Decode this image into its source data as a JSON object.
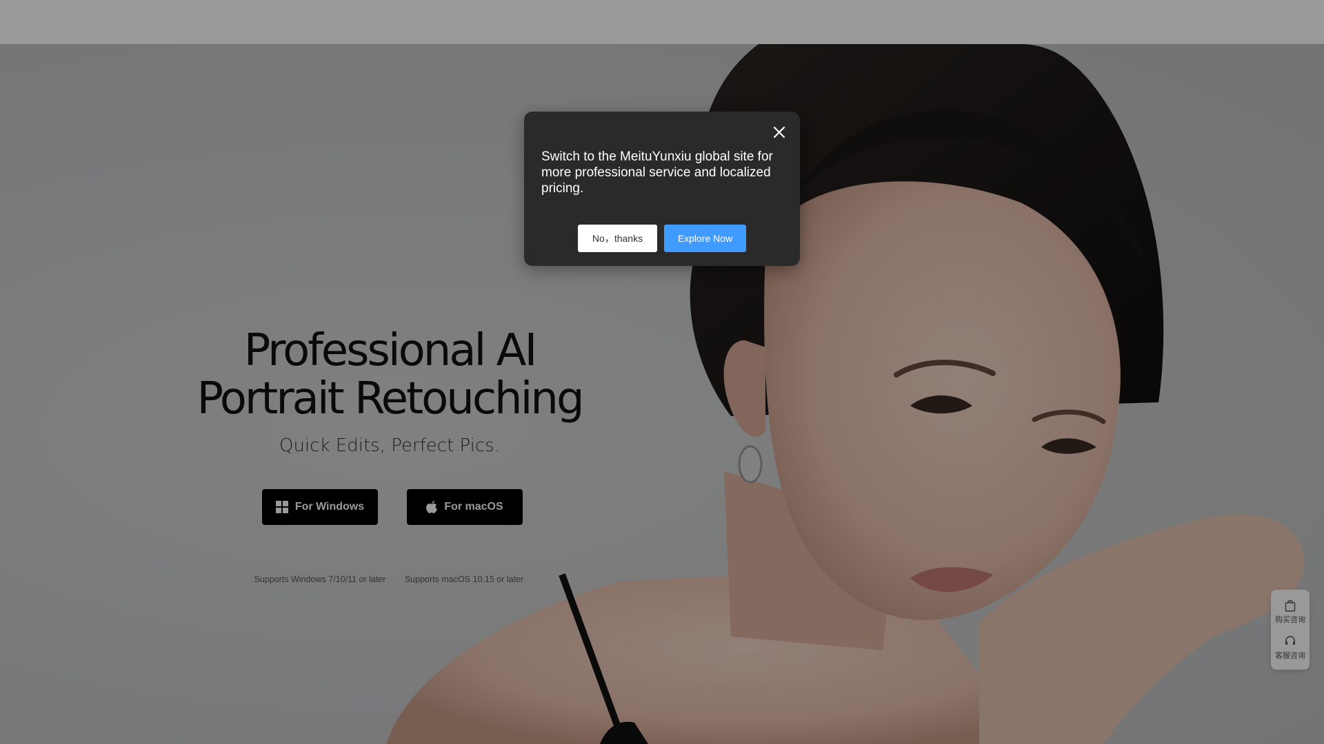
{
  "hero": {
    "title_line1": "Professional AI",
    "title_line2": "Portrait Retouching",
    "subtitle": "Quick Edits, Perfect Pics.",
    "download_windows": {
      "label": "For Windows",
      "note": "Supports Windows 7/10/11 or later",
      "icon": "windows-icon"
    },
    "download_mac": {
      "label": "For macOS",
      "note": "Supports macOS 10.15 or later",
      "icon": "apple-icon"
    },
    "image": "portrait-photo"
  },
  "side_widget": {
    "purchase_label": "购买咨询",
    "purchase_icon": "shopping-bag-icon",
    "support_label": "客服咨询",
    "support_icon": "headset-icon"
  },
  "modal": {
    "message": "Switch to the MeituYunxiu global site for more professional service and localized pricing.",
    "no_label": "No，thanks",
    "explore_label": "Explore Now",
    "close_icon": "close-icon"
  },
  "colors": {
    "modal_bg": "#2b2a2a",
    "explore_bg": "#3f9bff",
    "overlay": "rgba(0,0,0,0.4)",
    "button_bg": "#000000"
  }
}
